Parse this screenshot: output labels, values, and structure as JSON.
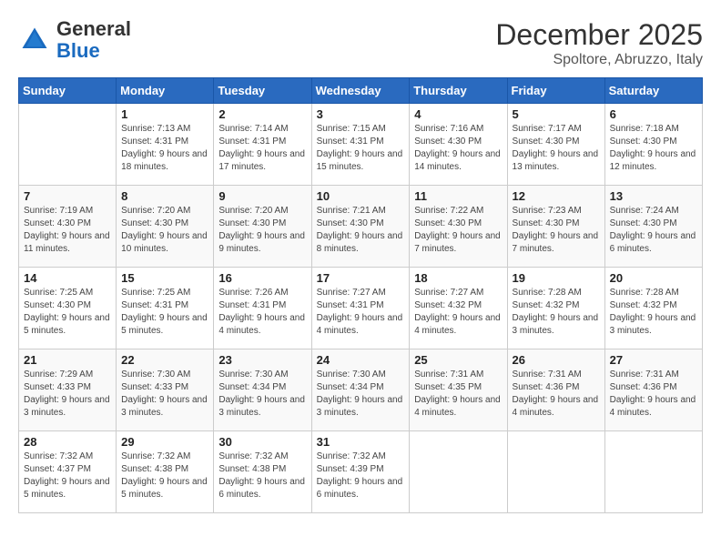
{
  "header": {
    "logo_general": "General",
    "logo_blue": "Blue",
    "month_title": "December 2025",
    "location": "Spoltore, Abruzzo, Italy"
  },
  "days_of_week": [
    "Sunday",
    "Monday",
    "Tuesday",
    "Wednesday",
    "Thursday",
    "Friday",
    "Saturday"
  ],
  "weeks": [
    [
      {
        "day": null
      },
      {
        "day": 1,
        "sunrise": "7:13 AM",
        "sunset": "4:31 PM",
        "daylight": "9 hours and 18 minutes."
      },
      {
        "day": 2,
        "sunrise": "7:14 AM",
        "sunset": "4:31 PM",
        "daylight": "9 hours and 17 minutes."
      },
      {
        "day": 3,
        "sunrise": "7:15 AM",
        "sunset": "4:31 PM",
        "daylight": "9 hours and 15 minutes."
      },
      {
        "day": 4,
        "sunrise": "7:16 AM",
        "sunset": "4:30 PM",
        "daylight": "9 hours and 14 minutes."
      },
      {
        "day": 5,
        "sunrise": "7:17 AM",
        "sunset": "4:30 PM",
        "daylight": "9 hours and 13 minutes."
      },
      {
        "day": 6,
        "sunrise": "7:18 AM",
        "sunset": "4:30 PM",
        "daylight": "9 hours and 12 minutes."
      }
    ],
    [
      {
        "day": 7,
        "sunrise": "7:19 AM",
        "sunset": "4:30 PM",
        "daylight": "9 hours and 11 minutes."
      },
      {
        "day": 8,
        "sunrise": "7:20 AM",
        "sunset": "4:30 PM",
        "daylight": "9 hours and 10 minutes."
      },
      {
        "day": 9,
        "sunrise": "7:20 AM",
        "sunset": "4:30 PM",
        "daylight": "9 hours and 9 minutes."
      },
      {
        "day": 10,
        "sunrise": "7:21 AM",
        "sunset": "4:30 PM",
        "daylight": "9 hours and 8 minutes."
      },
      {
        "day": 11,
        "sunrise": "7:22 AM",
        "sunset": "4:30 PM",
        "daylight": "9 hours and 7 minutes."
      },
      {
        "day": 12,
        "sunrise": "7:23 AM",
        "sunset": "4:30 PM",
        "daylight": "9 hours and 7 minutes."
      },
      {
        "day": 13,
        "sunrise": "7:24 AM",
        "sunset": "4:30 PM",
        "daylight": "9 hours and 6 minutes."
      }
    ],
    [
      {
        "day": 14,
        "sunrise": "7:25 AM",
        "sunset": "4:30 PM",
        "daylight": "9 hours and 5 minutes."
      },
      {
        "day": 15,
        "sunrise": "7:25 AM",
        "sunset": "4:31 PM",
        "daylight": "9 hours and 5 minutes."
      },
      {
        "day": 16,
        "sunrise": "7:26 AM",
        "sunset": "4:31 PM",
        "daylight": "9 hours and 4 minutes."
      },
      {
        "day": 17,
        "sunrise": "7:27 AM",
        "sunset": "4:31 PM",
        "daylight": "9 hours and 4 minutes."
      },
      {
        "day": 18,
        "sunrise": "7:27 AM",
        "sunset": "4:32 PM",
        "daylight": "9 hours and 4 minutes."
      },
      {
        "day": 19,
        "sunrise": "7:28 AM",
        "sunset": "4:32 PM",
        "daylight": "9 hours and 3 minutes."
      },
      {
        "day": 20,
        "sunrise": "7:28 AM",
        "sunset": "4:32 PM",
        "daylight": "9 hours and 3 minutes."
      }
    ],
    [
      {
        "day": 21,
        "sunrise": "7:29 AM",
        "sunset": "4:33 PM",
        "daylight": "9 hours and 3 minutes."
      },
      {
        "day": 22,
        "sunrise": "7:30 AM",
        "sunset": "4:33 PM",
        "daylight": "9 hours and 3 minutes."
      },
      {
        "day": 23,
        "sunrise": "7:30 AM",
        "sunset": "4:34 PM",
        "daylight": "9 hours and 3 minutes."
      },
      {
        "day": 24,
        "sunrise": "7:30 AM",
        "sunset": "4:34 PM",
        "daylight": "9 hours and 3 minutes."
      },
      {
        "day": 25,
        "sunrise": "7:31 AM",
        "sunset": "4:35 PM",
        "daylight": "9 hours and 4 minutes."
      },
      {
        "day": 26,
        "sunrise": "7:31 AM",
        "sunset": "4:36 PM",
        "daylight": "9 hours and 4 minutes."
      },
      {
        "day": 27,
        "sunrise": "7:31 AM",
        "sunset": "4:36 PM",
        "daylight": "9 hours and 4 minutes."
      }
    ],
    [
      {
        "day": 28,
        "sunrise": "7:32 AM",
        "sunset": "4:37 PM",
        "daylight": "9 hours and 5 minutes."
      },
      {
        "day": 29,
        "sunrise": "7:32 AM",
        "sunset": "4:38 PM",
        "daylight": "9 hours and 5 minutes."
      },
      {
        "day": 30,
        "sunrise": "7:32 AM",
        "sunset": "4:38 PM",
        "daylight": "9 hours and 6 minutes."
      },
      {
        "day": 31,
        "sunrise": "7:32 AM",
        "sunset": "4:39 PM",
        "daylight": "9 hours and 6 minutes."
      },
      {
        "day": null
      },
      {
        "day": null
      },
      {
        "day": null
      }
    ]
  ],
  "labels": {
    "sunrise": "Sunrise:",
    "sunset": "Sunset:",
    "daylight": "Daylight:"
  }
}
